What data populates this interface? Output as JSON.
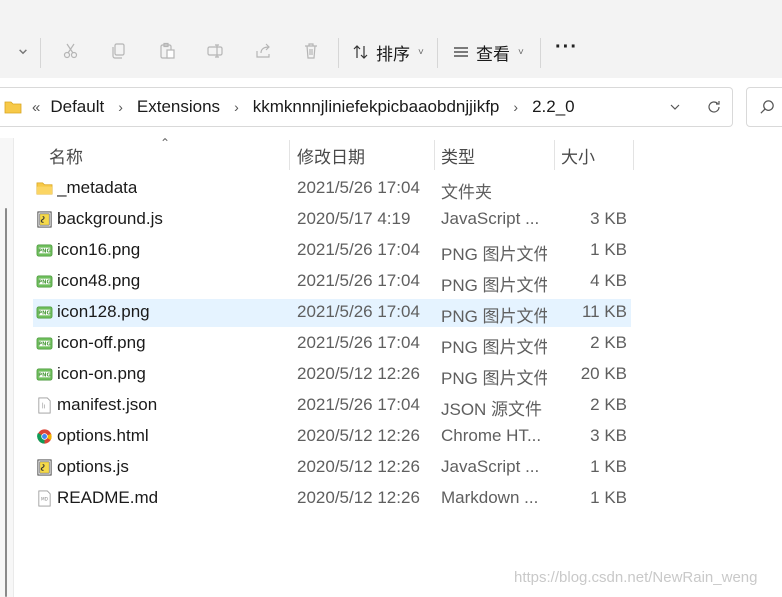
{
  "toolbar": {
    "sort_label": "排序",
    "view_label": "查看",
    "more_label": "···"
  },
  "address": {
    "overflow": "«",
    "crumbs": [
      "Default",
      "Extensions",
      "kkmknnnjliniefekpicbaaobdnjjikfp",
      "2.2_0"
    ]
  },
  "columns": {
    "name": "名称",
    "date": "修改日期",
    "type": "类型",
    "size": "大小"
  },
  "files": [
    {
      "name": "_metadata",
      "date": "2021/5/26 17:04",
      "type": "文件夹",
      "size": "",
      "icon": "folder-icon"
    },
    {
      "name": "background.js",
      "date": "2020/5/17 4:19",
      "type": "JavaScript ...",
      "size": "3 KB",
      "icon": "js-file-icon"
    },
    {
      "name": "icon16.png",
      "date": "2021/5/26 17:04",
      "type": "PNG 图片文件",
      "size": "1 KB",
      "icon": "png-file-icon"
    },
    {
      "name": "icon48.png",
      "date": "2021/5/26 17:04",
      "type": "PNG 图片文件",
      "size": "4 KB",
      "icon": "png-file-icon"
    },
    {
      "name": "icon128.png",
      "date": "2021/5/26 17:04",
      "type": "PNG 图片文件",
      "size": "11 KB",
      "icon": "png-file-icon",
      "selected": true
    },
    {
      "name": "icon-off.png",
      "date": "2021/5/26 17:04",
      "type": "PNG 图片文件",
      "size": "2 KB",
      "icon": "png-file-icon"
    },
    {
      "name": "icon-on.png",
      "date": "2020/5/12 12:26",
      "type": "PNG 图片文件",
      "size": "20 KB",
      "icon": "png-file-icon"
    },
    {
      "name": "manifest.json",
      "date": "2021/5/26 17:04",
      "type": "JSON 源文件",
      "size": "2 KB",
      "icon": "json-file-icon"
    },
    {
      "name": "options.html",
      "date": "2020/5/12 12:26",
      "type": "Chrome HT...",
      "size": "3 KB",
      "icon": "chrome-html-icon"
    },
    {
      "name": "options.js",
      "date": "2020/5/12 12:26",
      "type": "JavaScript ...",
      "size": "1 KB",
      "icon": "js-file-icon"
    },
    {
      "name": "README.md",
      "date": "2020/5/12 12:26",
      "type": "Markdown ...",
      "size": "1 KB",
      "icon": "md-file-icon"
    }
  ],
  "watermark": "https://blog.csdn.net/NewRain_weng",
  "colors": {
    "toolbar_bg": "#f3f3f3",
    "selected_row": "#e5f3ff",
    "folder_yellow": "#f7c948"
  }
}
